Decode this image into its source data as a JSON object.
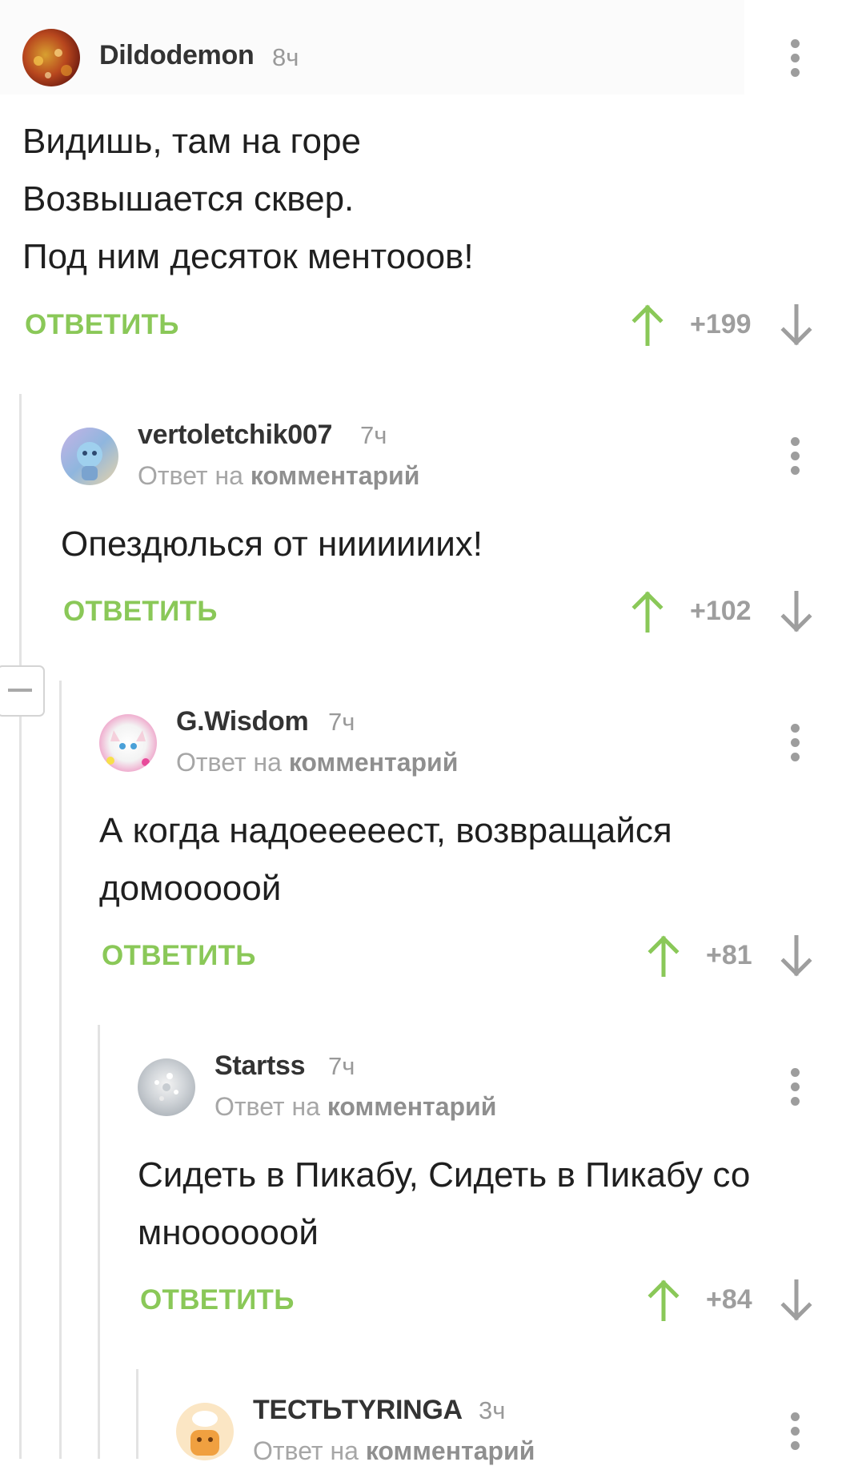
{
  "comments": [
    {
      "author": "Dildodemon",
      "time": "8ч",
      "reply_prefix": "",
      "reply_target": "",
      "lines": [
        "Видишь, там на горе",
        "Возвышается сквер.",
        "Под ним десяток ментооов!"
      ],
      "reply_label": "ОТВЕТИТЬ",
      "score": "+199"
    },
    {
      "author": "vertoletchik007",
      "time": "7ч",
      "reply_prefix": "Ответ на",
      "reply_target": "комментарий",
      "lines": [
        "Опездюлься от ниииииих!"
      ],
      "reply_label": "ОТВЕТИТЬ",
      "score": "+102"
    },
    {
      "author": "G.Wisdom",
      "time": "7ч",
      "reply_prefix": "Ответ на",
      "reply_target": "комментарий",
      "lines": [
        "А когда надоееееест, возвращайся",
        "домооооой"
      ],
      "reply_label": "ОТВЕТИТЬ",
      "score": "+81"
    },
    {
      "author": "Startss",
      "time": "7ч",
      "reply_prefix": "Ответ на",
      "reply_target": "комментарий",
      "lines": [
        "Сидеть в Пикабу, Сидеть в Пикабу со",
        "мноооооой"
      ],
      "reply_label": "ОТВЕТИТЬ",
      "score": "+84"
    },
    {
      "author": "ТЕСТЬTYRINGA",
      "time": "3ч",
      "reply_prefix": "Ответ на",
      "reply_target": "комментарий",
      "lines": [],
      "reply_label": "",
      "score": ""
    }
  ],
  "colors": {
    "accent_green": "#8ac858",
    "muted_gray": "#9e9e9e",
    "thread_line": "#e3e3e3"
  },
  "icons": {
    "upvote": "arrow-up-icon",
    "downvote": "arrow-down-icon",
    "menu": "more-vertical-icon",
    "collapse": "minus-icon"
  }
}
